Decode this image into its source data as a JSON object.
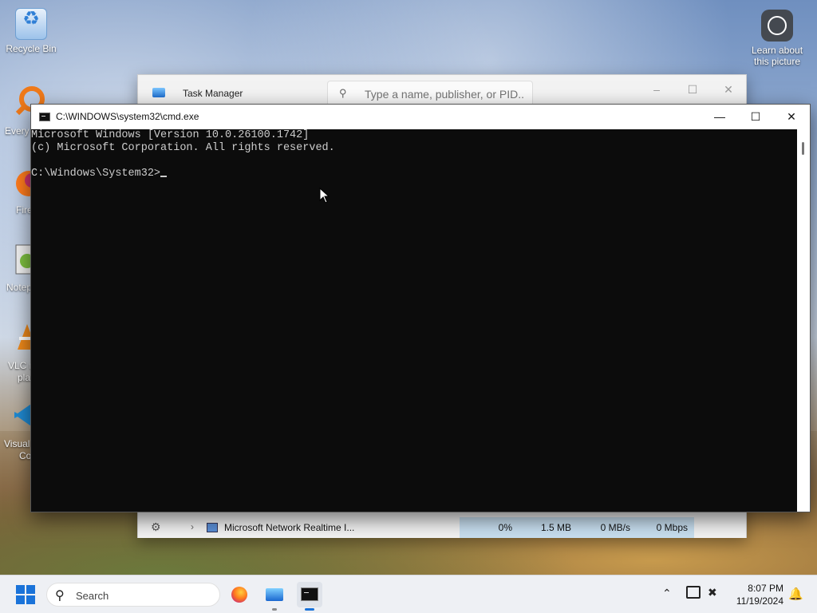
{
  "desktop": {
    "icons": {
      "recycle_bin": "Recycle Bin",
      "learn_about_line1": "Learn about",
      "learn_about_line2": "this picture",
      "everything": "Every",
      "firefox": "Fire",
      "notepad": "Notep",
      "vlc_line1": "VLC m",
      "vlc_line2": "pla",
      "vscode_line1": "Visual",
      "vscode_line2": "Co"
    }
  },
  "task_manager": {
    "title": "Task Manager",
    "search_placeholder": "Type a name, publisher, or PID...",
    "minimize": "–",
    "maximize": "☐",
    "close": "✕",
    "row": {
      "name": "Microsoft Network Realtime I...",
      "cpu": "0%",
      "memory": "1.5 MB",
      "disk": "0 MB/s",
      "network": "0 Mbps"
    }
  },
  "cmd": {
    "title": "C:\\WINDOWS\\system32\\cmd.exe",
    "minimize": "—",
    "maximize": "☐",
    "close": "✕",
    "lines": [
      "Microsoft Windows [Version 10.0.26100.1742]",
      "(c) Microsoft Corporation. All rights reserved.",
      "",
      "C:\\Windows\\System32>"
    ]
  },
  "taskbar": {
    "search_label": "Search",
    "time": "8:07 PM",
    "date": "11/19/2024",
    "accent": "#1a73d9",
    "active_indicator": "#1a73d9",
    "inactive_indicator": "#8a8a8a"
  }
}
